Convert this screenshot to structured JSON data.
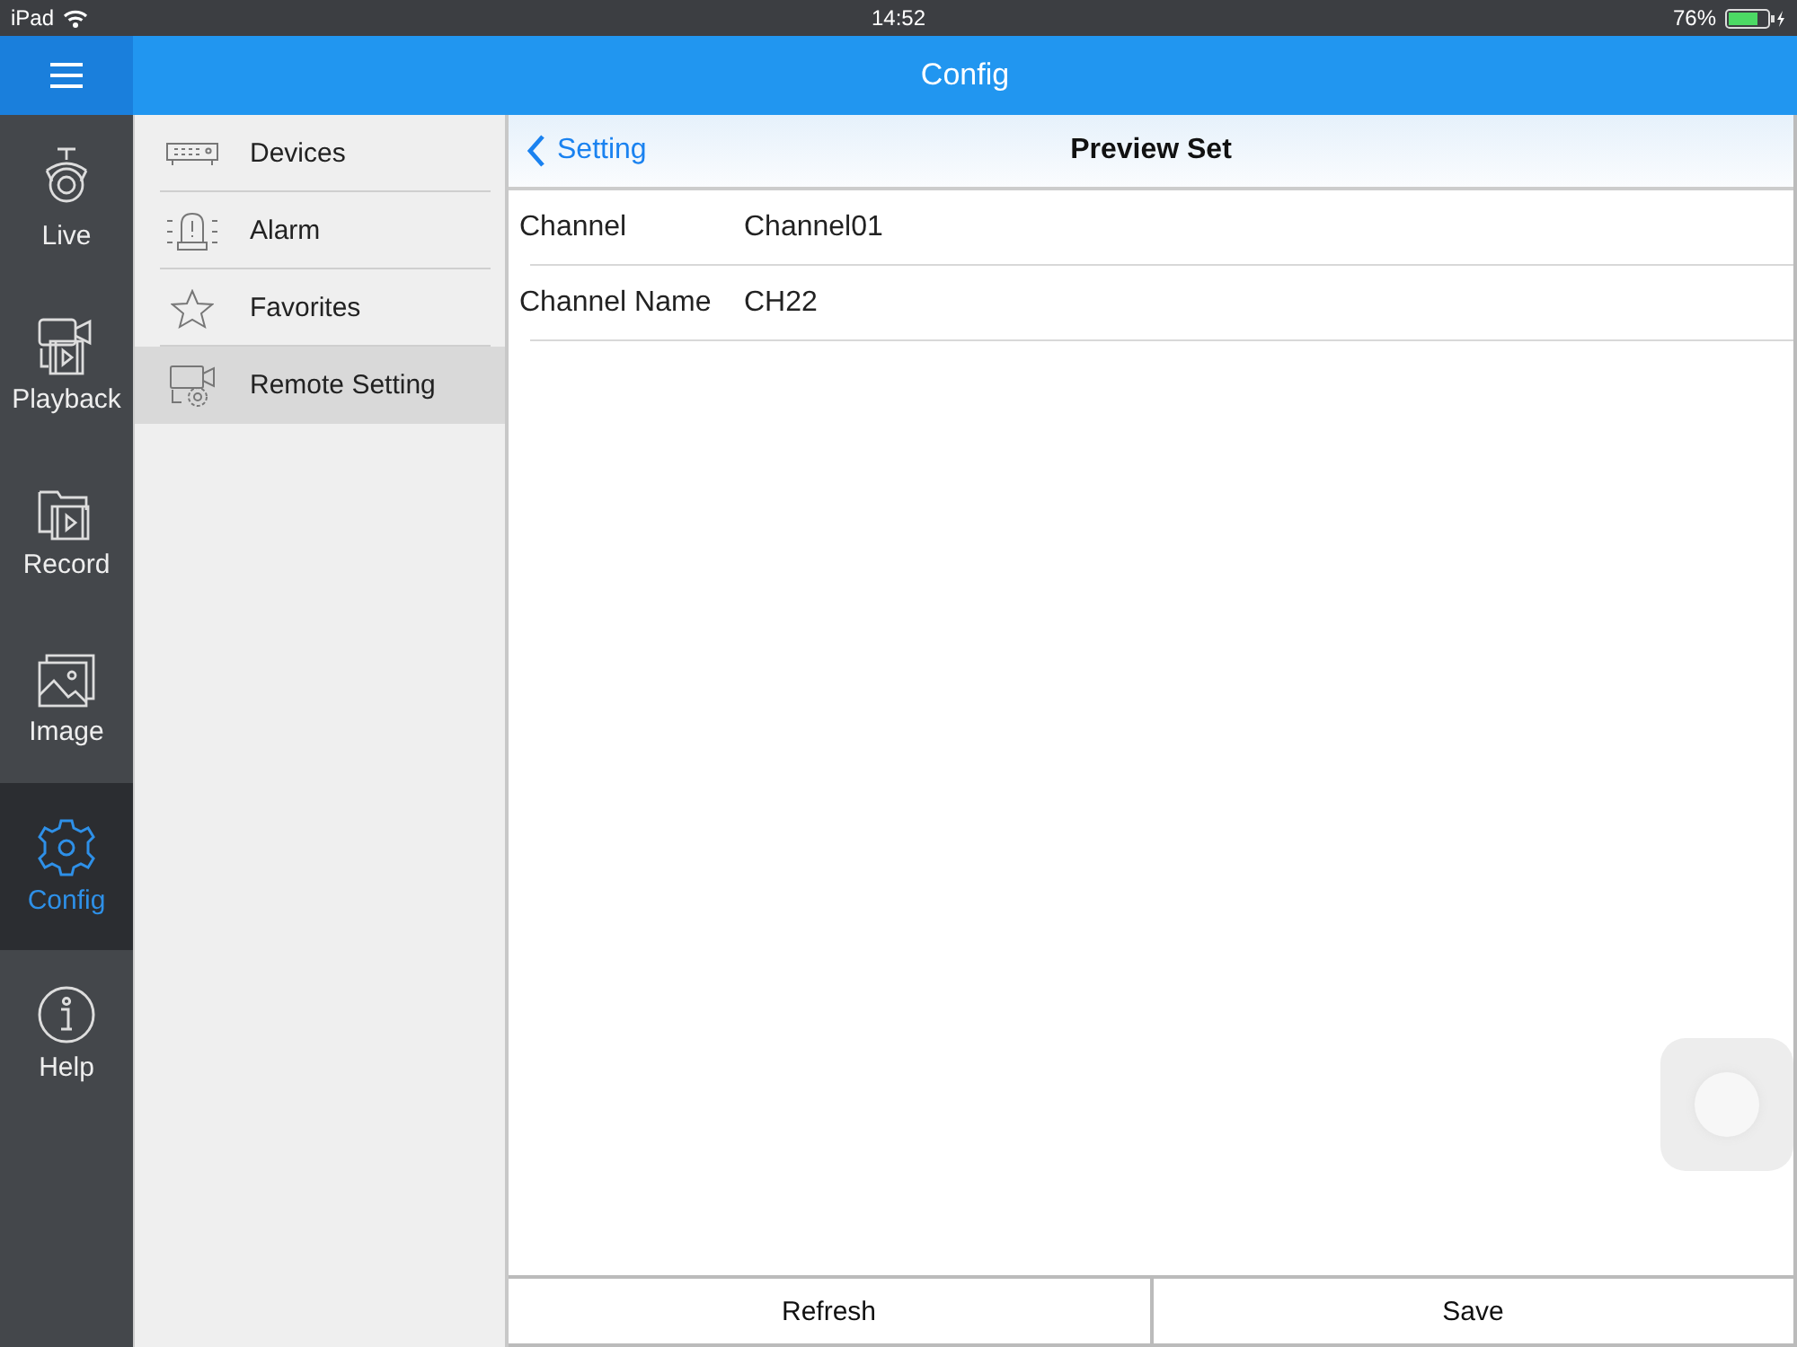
{
  "status_bar": {
    "carrier": "iPad",
    "time": "14:52",
    "battery": "76%"
  },
  "header": {
    "title": "Config"
  },
  "nav": [
    {
      "kind": "live",
      "label": "Live",
      "selected": false
    },
    {
      "kind": "playback",
      "label": "Playback",
      "selected": false
    },
    {
      "kind": "record",
      "label": "Record",
      "selected": false
    },
    {
      "kind": "image",
      "label": "Image",
      "selected": false
    },
    {
      "kind": "config",
      "label": "Config",
      "selected": true
    },
    {
      "kind": "help",
      "label": "Help",
      "selected": false
    }
  ],
  "menu": [
    {
      "kind": "devices",
      "label": "Devices",
      "selected": false
    },
    {
      "kind": "alarm",
      "label": "Alarm",
      "selected": false
    },
    {
      "kind": "favorites",
      "label": "Favorites",
      "selected": false
    },
    {
      "kind": "remote",
      "label": "Remote Setting",
      "selected": true
    }
  ],
  "panel": {
    "back": "Setting",
    "title": "Preview Set",
    "rows": [
      {
        "label": "Channel",
        "value": "Channel01"
      },
      {
        "label": "Channel Name",
        "value": "CH22"
      }
    ],
    "buttons": [
      "Refresh",
      "Save"
    ]
  }
}
